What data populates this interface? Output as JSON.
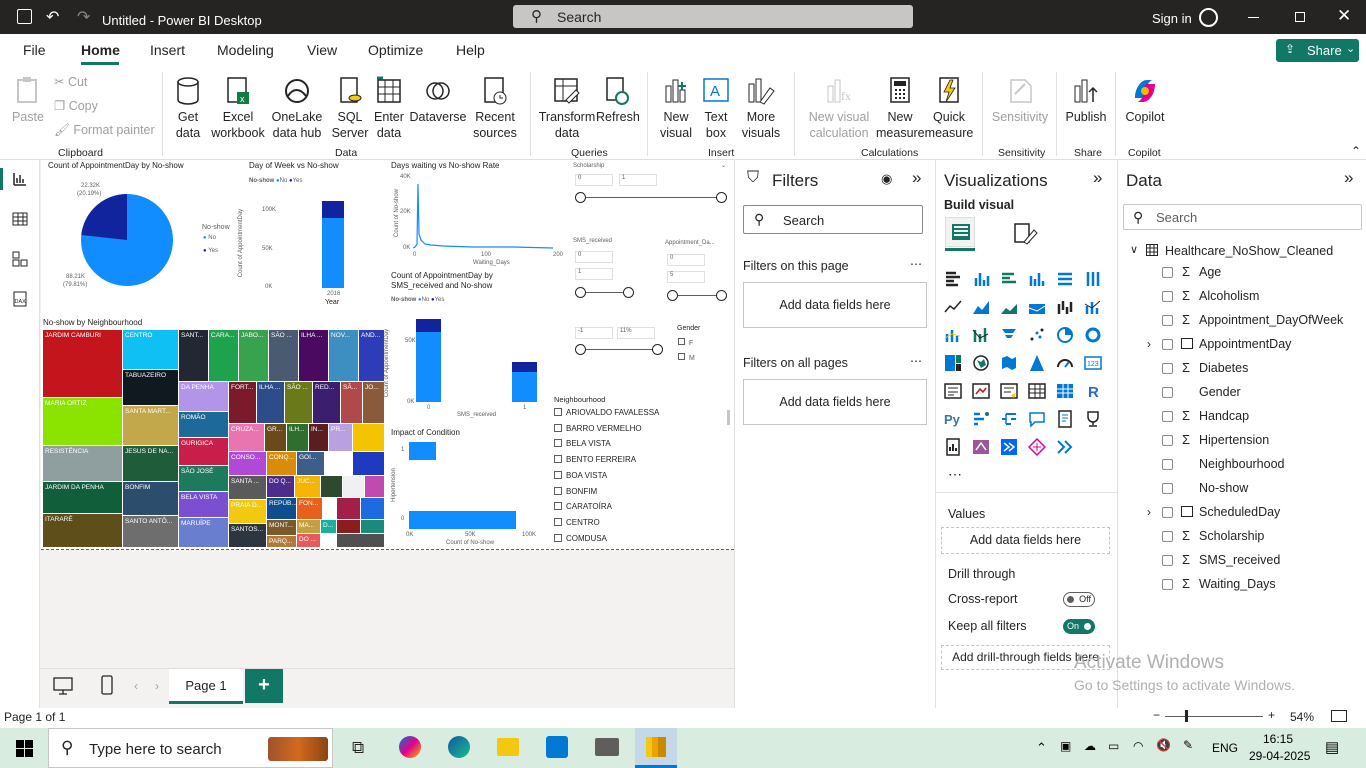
{
  "window": {
    "title": "Untitled - Power BI Desktop",
    "search_placeholder": "Search",
    "sign_in": "Sign in",
    "share": "Share"
  },
  "menu": [
    "File",
    "Home",
    "Insert",
    "Modeling",
    "View",
    "Optimize",
    "Help"
  ],
  "ribbon": {
    "clipboard": {
      "paste": "Paste",
      "cut": "Cut",
      "copy": "Copy",
      "format_painter": "Format painter",
      "group": "Clipboard"
    },
    "data": {
      "get_data": "Get data",
      "excel": "Excel workbook",
      "onelake": "OneLake data hub",
      "sql": "SQL Server",
      "enter": "Enter data",
      "dataverse": "Dataverse",
      "recent": "Recent sources",
      "group": "Data"
    },
    "queries": {
      "transform": "Transform data",
      "refresh": "Refresh",
      "group": "Queries"
    },
    "insert": {
      "new_visual": "New visual",
      "text_box": "Text box",
      "more_visuals": "More visuals",
      "group": "Insert"
    },
    "calculations": {
      "new_visual_calc": "New visual calculation",
      "new_measure": "New measure",
      "quick_measure": "Quick measure",
      "group": "Calculations"
    },
    "sensitivity": {
      "label": "Sensitivity",
      "group": "Sensitivity"
    },
    "share": {
      "publish": "Publish",
      "group": "Share"
    },
    "copilot": {
      "label": "Copilot",
      "group": "Copilot"
    }
  },
  "report": {
    "pie": {
      "title": "Count of AppointmentDay by No-show",
      "legend_title": "No-show",
      "legend": [
        "No",
        "Yes"
      ],
      "label_yes": "22.32K",
      "label_yes_pct": "(20.19%)",
      "label_no": "88.21K",
      "label_no_pct": "(79.81%)"
    },
    "dow": {
      "title": "Day of Week vs No-show",
      "legend_title": "No-show",
      "legend": [
        "No",
        "Yes"
      ],
      "ylabel": "Count of AppointmentDay",
      "xlabel": "Year",
      "xtick": "2016",
      "yticks": [
        "100K",
        "50K",
        "0K"
      ]
    },
    "wait": {
      "title": "Days waiting vs No-show Rate",
      "ylabel": "Count of No-show",
      "xlabel": "Waiting_Days",
      "yticks": [
        "40K",
        "20K",
        "0K"
      ],
      "xticks": [
        "0",
        "100",
        "200"
      ]
    },
    "sms": {
      "title": "Count of AppointmentDay by SMS_received and No-show",
      "legend_title": "No-show",
      "legend": [
        "No",
        "Yes"
      ],
      "ylabel": "Count of AppointmentDay",
      "xlabel": "SMS_received",
      "yticks": [
        "50K",
        "0K"
      ],
      "xticks": [
        "0",
        "1"
      ]
    },
    "cond": {
      "title": "Impact of Condition",
      "ylabel": "Hipertension",
      "xlabel": "Count of No-show",
      "yticks": [
        "1",
        "0"
      ],
      "xticks": [
        "0K",
        "50K",
        "100K"
      ]
    },
    "slicers": {
      "scholarship": "Scholarship",
      "sch_min": "0",
      "sch_max": "1",
      "sms": "SMS_received",
      "sms_min": "0",
      "sms_max": "1",
      "dow": "Appointment_Da...",
      "dow_min": "0",
      "dow_max": "5",
      "third_min": "-1",
      "third_max": "11%",
      "gender": "Gender",
      "gender_opts": [
        "F",
        "M"
      ]
    },
    "neighbourhood": {
      "title": "Neighbourhood",
      "items": [
        "ARIOVALDO FAVALESSA",
        "BARRO VERMELHO",
        "BELA VISTA",
        "BENTO FERREIRA",
        "BOA VISTA",
        "BONFIM",
        "CARATOÍRA",
        "CENTRO",
        "COMDUSA"
      ]
    },
    "treemap": {
      "title": "No-show by Neighbourhood",
      "cells": [
        "JARDIM CAMBURI",
        "CENTRO",
        "SANT...",
        "CARA...",
        "JABO...",
        "SÃO ...",
        "ILHA ...",
        "NOV...",
        "AND...",
        "TABUAZEIRO",
        "MARIA ORTIZ",
        "SANTA MART...",
        "DA PENHA",
        "FORT...",
        "ILHA ...",
        "SÃO ...",
        "RED...",
        "SÃ...",
        "JO...",
        "ROMÃO",
        "RESISTÊNCIA",
        "JESUS DE NA...",
        "CRUZA...",
        "GR...",
        "ILH...",
        "IN...",
        "PR...",
        "GURIGICA",
        "CONSO...",
        "CONQ...",
        "GOI...",
        "JARDIM DA PENHA",
        "BONFIM",
        "SÃO JOSÉ",
        "SANTA ...",
        "DO Q...",
        "JUC...",
        "BELA VISTA",
        "PRAIA D...",
        "REPÚB...",
        "FON...",
        "ITARARÉ",
        "SANTO ANTÔ...",
        "MARUÍPE",
        "SANTOS...",
        "MONT...",
        "MA...",
        "D...",
        "PARQ...",
        "DO ..."
      ]
    }
  },
  "filters": {
    "title": "Filters",
    "search": "Search",
    "this_page": "Filters on this page",
    "all_pages": "Filters on all pages",
    "add": "Add data fields here"
  },
  "viz": {
    "title": "Visualizations",
    "build": "Build visual",
    "values": "Values",
    "values_add": "Add data fields here",
    "drill": "Drill through",
    "cross": "Cross-report",
    "cross_state": "Off",
    "keep": "Keep all filters",
    "keep_state": "On",
    "drill_add": "Add drill-through fields here"
  },
  "data_pane": {
    "title": "Data",
    "search": "Search",
    "table": "Healthcare_NoShow_Cleaned",
    "fields": [
      "Age",
      "Alcoholism",
      "Appointment_DayOfWeek",
      "AppointmentDay",
      "Diabetes",
      "Gender",
      "Handcap",
      "Hipertension",
      "Neighbourhood",
      "No-show",
      "ScheduledDay",
      "Scholarship",
      "SMS_received",
      "Waiting_Days"
    ],
    "sigma": [
      true,
      true,
      true,
      false,
      true,
      false,
      true,
      true,
      false,
      false,
      false,
      true,
      true,
      true
    ],
    "expand": [
      false,
      false,
      false,
      true,
      false,
      false,
      false,
      false,
      false,
      false,
      true,
      false,
      false,
      false
    ]
  },
  "pages": {
    "tab": "Page 1",
    "add": "+"
  },
  "status": {
    "page": "Page 1 of 1",
    "zoom": "54%",
    "activate1": "Activate Windows",
    "activate2": "Go to Settings to activate Windows."
  },
  "taskbar": {
    "search": "Type here to search",
    "time": "16:15",
    "date": "29-04-2025",
    "lang": "ENG"
  },
  "colors": {
    "accent": "#117865",
    "no": "#118DFF",
    "yes": "#12239E"
  }
}
